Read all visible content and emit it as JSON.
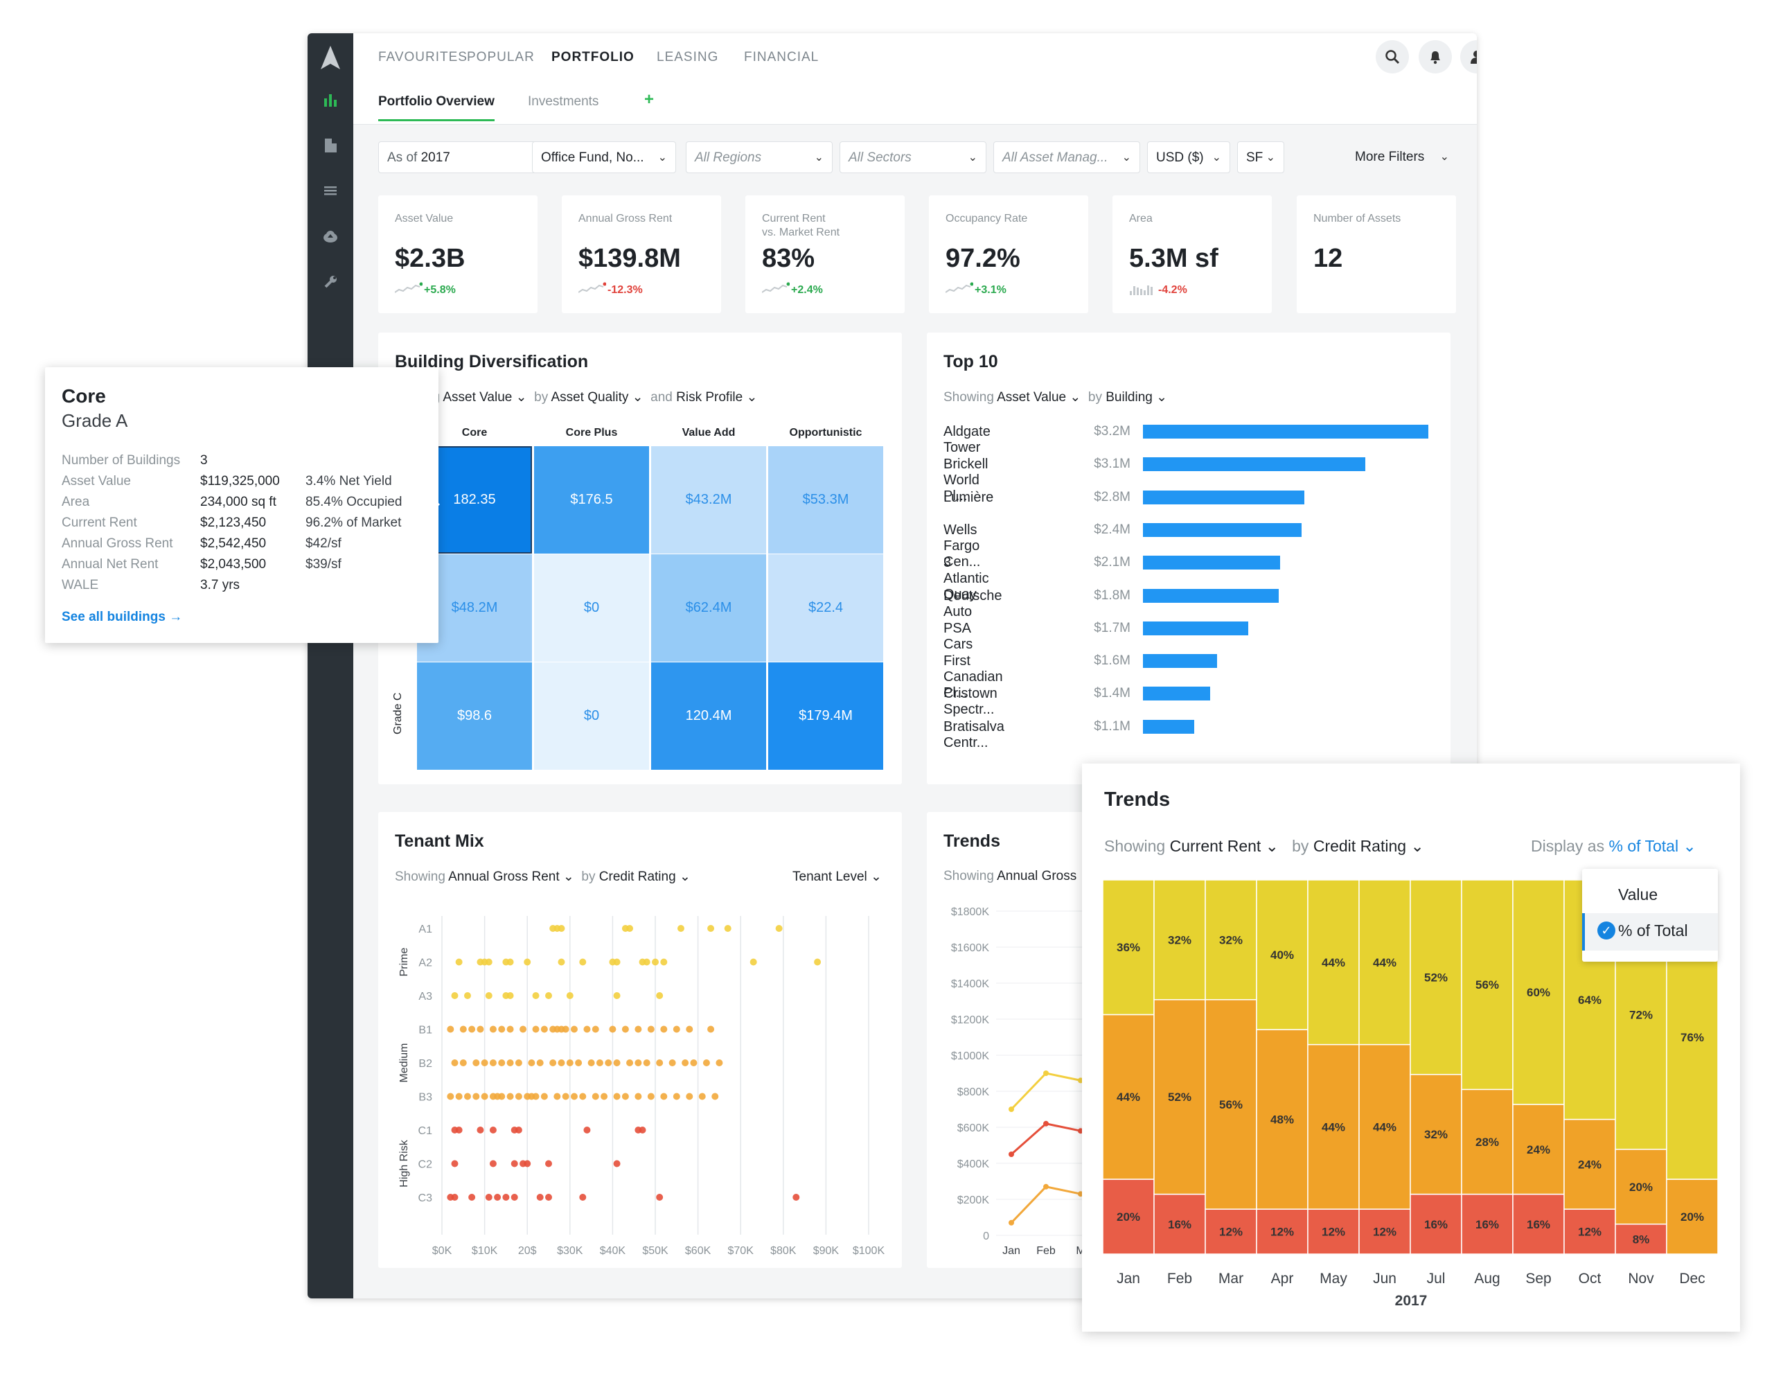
{
  "nav": {
    "items": [
      "FAVOURITES",
      "POPULAR",
      "PORTFOLIO",
      "LEASING",
      "FINANCIAL"
    ],
    "active": "PORTFOLIO",
    "subtabs": [
      "Portfolio Overview",
      "Investments"
    ],
    "add_tab": "+"
  },
  "filters": {
    "as_of_prefix": "As of",
    "as_of_year": "2017",
    "fund": "Office Fund, No...",
    "regions": "All Regions",
    "sectors": "All Sectors",
    "asset_managers": "All Asset Manag...",
    "currency": "USD ($)",
    "unit": "SF",
    "more": "More Filters"
  },
  "kpis": [
    {
      "label": "Asset Value",
      "value": "$2.3B",
      "delta": "+5.8%",
      "dir": "pos",
      "spark": "line"
    },
    {
      "label": "Annual Gross Rent",
      "value": "$139.8M",
      "delta": "-12.3%",
      "dir": "neg",
      "spark": "line"
    },
    {
      "label": "Current Rent\nvs. Market Rent",
      "value": "83%",
      "delta": "+2.4%",
      "dir": "pos",
      "spark": "line"
    },
    {
      "label": "Occupancy Rate",
      "value": "97.2%",
      "delta": "+3.1%",
      "dir": "pos",
      "spark": "line"
    },
    {
      "label": "Area",
      "value": "5.3M sf",
      "delta": "-4.2%",
      "dir": "neg",
      "spark": "bars"
    },
    {
      "label": "Number of Assets",
      "value": "12",
      "delta": "",
      "dir": "pos",
      "spark": "none"
    }
  ],
  "building_div": {
    "title": "Building Diversification",
    "showing_prefix": "ng",
    "measure": "Asset Value",
    "by_prefix": "by",
    "by": "Asset Quality",
    "and_prefix": "and",
    "and": "Risk Profile",
    "columns": [
      "Core",
      "Core Plus",
      "Value Add",
      "Opportunistic"
    ],
    "row_label_visible": "Grade C",
    "cells": [
      [
        "182.35",
        "$176.5",
        "$43.2M",
        "$53.3M"
      ],
      [
        "$48.2M",
        "$0",
        "$62.4M",
        "$22.4"
      ],
      [
        "$98.6",
        "$0",
        "120.4M",
        "$179.4M"
      ]
    ],
    "cell_colors": [
      [
        "#0a7ee6",
        "#3d9ff0",
        "#c0dffa",
        "#a9d3f9"
      ],
      [
        "#a0cff8",
        "#e4f2fd",
        "#96cbf7",
        "#c7e2fb"
      ],
      [
        "#55acf2",
        "#e4f2fd",
        "#2e96ef",
        "#1e8ef0"
      ]
    ]
  },
  "tooltip": {
    "title": "Core",
    "subtitle": "Grade A",
    "rows": [
      {
        "k": "Number of Buildings",
        "v": "3",
        "x": ""
      },
      {
        "k": "Asset Value",
        "v": "$119,325,000",
        "x": "3.4% Net Yield"
      },
      {
        "k": "Area",
        "v": "234,000 sq ft",
        "x": "85.4% Occupied"
      },
      {
        "k": "Current Rent",
        "v": "$2,123,450",
        "x": "96.2% of Market"
      },
      {
        "k": "Annual Gross Rent",
        "v": "$2,542,450",
        "x": "$42/sf"
      },
      {
        "k": "Annual Net Rent",
        "v": "$2,043,500",
        "x": "$39/sf"
      },
      {
        "k": "WALE",
        "v": "3.7 yrs",
        "x": ""
      }
    ],
    "link": "See all buildings →"
  },
  "top10": {
    "title": "Top 10",
    "showing_prefix": "Showing",
    "measure": "Asset Value",
    "by_prefix": "by",
    "by": "Building",
    "chart_data": {
      "type": "bar",
      "categories": [
        "Aldgate Tower",
        "Brickell World Pl...",
        "Lumière",
        "Wells Fargo Cen...",
        "3 Atlantic Quay",
        "Deutsche Auto",
        "PSA Cars",
        "First Canadian Pl...",
        "Cristown Spectr...",
        "Bratisalva Centr..."
      ],
      "values": [
        3.2,
        3.1,
        2.8,
        2.4,
        2.1,
        1.8,
        1.7,
        1.6,
        1.4,
        1.1
      ],
      "value_labels": [
        "$3.2M",
        "$3.1M",
        "$2.8M",
        "$2.4M",
        "$2.1M",
        "$1.8M",
        "$1.7M",
        "$1.6M",
        "$1.4M",
        "$1.1M"
      ],
      "bar_fractions": [
        1.0,
        0.78,
        0.565,
        0.555,
        0.48,
        0.475,
        0.37,
        0.26,
        0.235,
        0.18
      ],
      "color": "#2196f3"
    }
  },
  "tenant_mix": {
    "title": "Tenant Mix",
    "showing_prefix": "Showing",
    "measure": "Annual Gross Rent",
    "by_prefix": "by",
    "by": "Credit Rating",
    "level": "Tenant Level",
    "groups": [
      "Prime",
      "Medium",
      "High Risk"
    ],
    "chart_data": {
      "type": "scatter",
      "y_categories": [
        "A1",
        "A2",
        "A3",
        "B1",
        "B2",
        "B3",
        "C1",
        "C2",
        "C3"
      ],
      "x_ticks": [
        "$0K",
        "$10K",
        "20$",
        "$30K",
        "$40K",
        "$50K",
        "$60K",
        "$70K",
        "$80K",
        "$90K",
        "$100K"
      ],
      "xlim": [
        0,
        100
      ],
      "colors": {
        "A": "#f3cf3f",
        "B": "#f2a83b",
        "C": "#e54f3a"
      },
      "points": {
        "A1": [
          26,
          27,
          28,
          43,
          44,
          56,
          63,
          67,
          79
        ],
        "A2": [
          4,
          9,
          10,
          11,
          15,
          16,
          20,
          28,
          33,
          40,
          41,
          47,
          48,
          50,
          52,
          73,
          88
        ],
        "A3": [
          3,
          6,
          11,
          15,
          16,
          22,
          25,
          30,
          41,
          51
        ],
        "B1": [
          2,
          5,
          7,
          9,
          12,
          14,
          16,
          19,
          22,
          24,
          26,
          27,
          28,
          29,
          31,
          34,
          36,
          40,
          43,
          46,
          49,
          52,
          55,
          58,
          63
        ],
        "B2": [
          3,
          5,
          8,
          10,
          12,
          14,
          16,
          18,
          21,
          23,
          26,
          28,
          30,
          32,
          35,
          37,
          39,
          41,
          44,
          46,
          48,
          51,
          54,
          57,
          59,
          62,
          65
        ],
        "B3": [
          2,
          4,
          6,
          8,
          10,
          12,
          13,
          14,
          16,
          18,
          20,
          21,
          22,
          24,
          27,
          29,
          31,
          33,
          36,
          38,
          41,
          43,
          46,
          49,
          52,
          55,
          58,
          61,
          64
        ],
        "C1": [
          3,
          4,
          9,
          12,
          17,
          18,
          34,
          46,
          47
        ],
        "C2": [
          3,
          12,
          17,
          19,
          20,
          25,
          41
        ],
        "C3": [
          2,
          3,
          7,
          11,
          13,
          15,
          17,
          23,
          25,
          33,
          51,
          83
        ]
      }
    }
  },
  "trends_small": {
    "title": "Trends",
    "showing_prefix": "Showing",
    "measure": "Annual Gross",
    "chart_data": {
      "type": "line",
      "y_ticks": [
        "$1800K",
        "$1600K",
        "$1400K",
        "$1200K",
        "$1000K",
        "$800K",
        "$600K",
        "$400K",
        "$200K",
        "0"
      ],
      "x": [
        "Jan",
        "Feb",
        "M"
      ],
      "series": [
        {
          "color": "#f3cf3f",
          "values": [
            700,
            900,
            860
          ]
        },
        {
          "color": "#e54f3a",
          "values": [
            450,
            620,
            580
          ]
        },
        {
          "color": "#f2a83b",
          "values": [
            70,
            270,
            230
          ]
        }
      ],
      "ylim": [
        0,
        1800
      ]
    }
  },
  "trends_pop": {
    "title": "Trends",
    "showing_prefix": "Showing",
    "measure": "Current Rent",
    "by_prefix": "by",
    "by": "Credit Rating",
    "display_prefix": "Display as",
    "display": "% of Total",
    "dropdown": {
      "options": [
        "Value",
        "% of Total"
      ],
      "selected": "% of Total"
    },
    "xlabel": "2017",
    "chart_data": {
      "type": "bar",
      "stacked": true,
      "categories": [
        "Jan",
        "Feb",
        "Mar",
        "Apr",
        "May",
        "Jun",
        "Jul",
        "Aug",
        "Sep",
        "Oct",
        "Nov",
        "Dec"
      ],
      "series": [
        {
          "color": "#e6d230",
          "values": [
            36,
            32,
            32,
            40,
            44,
            44,
            52,
            56,
            60,
            64,
            72,
            76
          ],
          "labels": [
            "36%",
            "32%",
            "32%",
            "40%",
            "44%",
            "44%",
            "52%",
            "56%",
            "60%",
            "64%",
            "72%",
            "76%"
          ]
        },
        {
          "color": "#f0a228",
          "values": [
            44,
            52,
            56,
            48,
            44,
            44,
            32,
            28,
            24,
            24,
            20,
            20
          ],
          "labels": [
            "44%",
            "52%",
            "56%",
            "48%",
            "44%",
            "44%",
            "32%",
            "28%",
            "24%",
            "24%",
            "20%",
            "20%"
          ]
        },
        {
          "color": "#e85d47",
          "values": [
            20,
            16,
            12,
            12,
            12,
            12,
            16,
            16,
            16,
            12,
            8,
            0
          ],
          "labels": [
            "20%",
            "16%",
            "12%",
            "12%",
            "12%",
            "12%",
            "16%",
            "16%",
            "16%",
            "12%",
            "8%",
            ""
          ]
        }
      ],
      "ylim": [
        0,
        100
      ]
    }
  }
}
